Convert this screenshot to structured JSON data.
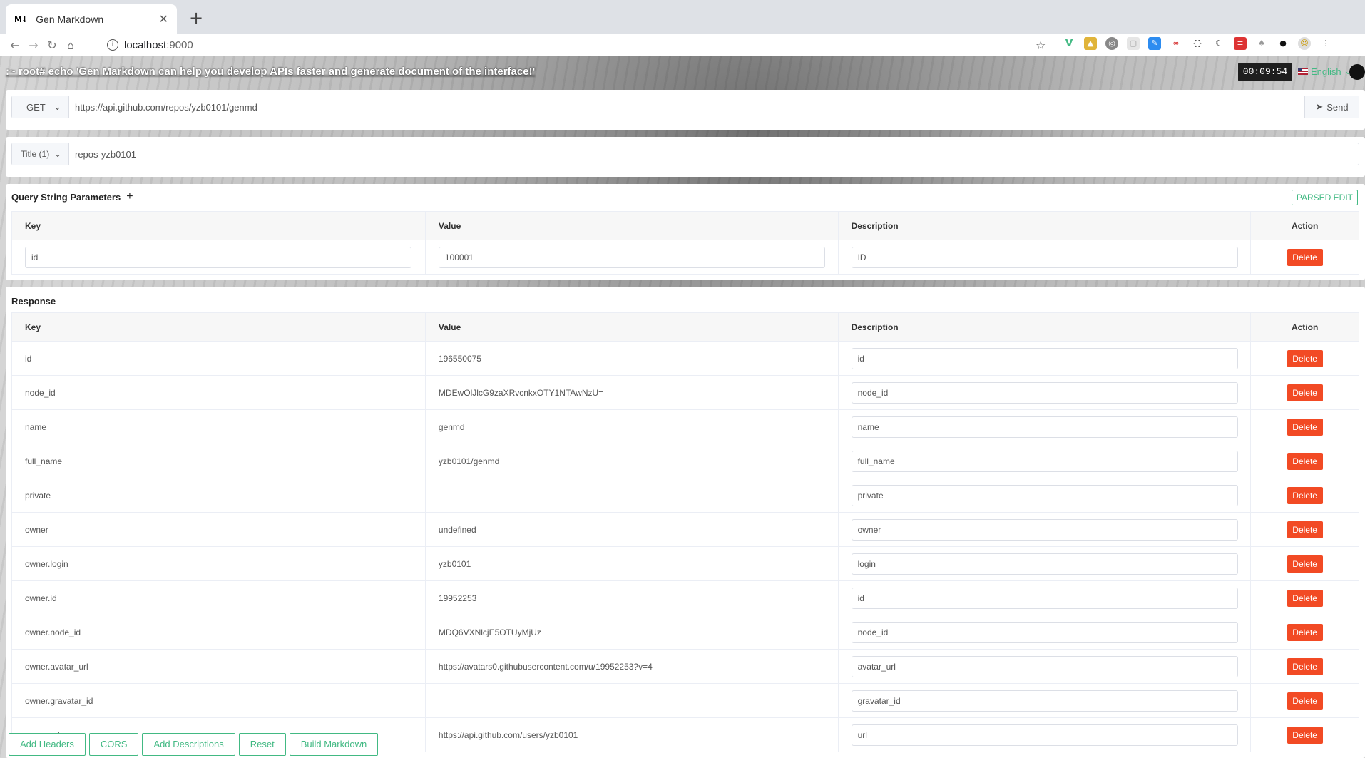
{
  "browser": {
    "tab_title": "Gen Markdown",
    "tab_favicon": "M↓",
    "url_host": "localhost",
    "url_port": ":9000"
  },
  "page": {
    "banner": ":~ root# echo 'Gen Markdown can help you develop APIs faster and generate document of the interface!'",
    "clock": "00:09:54",
    "language": "English"
  },
  "request": {
    "method": "GET",
    "url": "https://api.github.com/repos/yzb0101/genmd",
    "send_label": "Send"
  },
  "title_field": {
    "select_label": "Title (1)",
    "value": "repos-yzb0101"
  },
  "query": {
    "heading": "Query String Parameters",
    "parsed_edit_label": "PARSED EDIT",
    "columns": [
      "Key",
      "Value",
      "Description",
      "Action"
    ],
    "rows": [
      {
        "key": "id",
        "value": "100001",
        "description": "ID",
        "action": "Delete"
      }
    ]
  },
  "response": {
    "heading": "Response",
    "columns": [
      "Key",
      "Value",
      "Description",
      "Action"
    ],
    "rows": [
      {
        "key": "id",
        "value": "196550075",
        "description": "id",
        "action": "Delete"
      },
      {
        "key": "node_id",
        "value": "MDEwOlJlcG9zaXRvcnkxOTY1NTAwNzU=",
        "description": "node_id",
        "action": "Delete"
      },
      {
        "key": "name",
        "value": "genmd",
        "description": "name",
        "action": "Delete"
      },
      {
        "key": "full_name",
        "value": "yzb0101/genmd",
        "description": "full_name",
        "action": "Delete"
      },
      {
        "key": "private",
        "value": "",
        "description": "private",
        "action": "Delete"
      },
      {
        "key": "owner",
        "value": "undefined",
        "description": "owner",
        "action": "Delete"
      },
      {
        "key": "owner.login",
        "value": "yzb0101",
        "description": "login",
        "action": "Delete"
      },
      {
        "key": "owner.id",
        "value": "19952253",
        "description": "id",
        "action": "Delete"
      },
      {
        "key": "owner.node_id",
        "value": "MDQ6VXNlcjE5OTUyMjUz",
        "description": "node_id",
        "action": "Delete"
      },
      {
        "key": "owner.avatar_url",
        "value": "https://avatars0.githubusercontent.com/u/19952253?v=4",
        "description": "avatar_url",
        "action": "Delete"
      },
      {
        "key": "owner.gravatar_id",
        "value": "",
        "description": "gravatar_id",
        "action": "Delete"
      },
      {
        "key": "owner.url",
        "value": "https://api.github.com/users/yzb0101",
        "description": "url",
        "action": "Delete"
      }
    ]
  },
  "actions": {
    "buttons": [
      "Add Headers",
      "CORS",
      "Add Descriptions",
      "Reset",
      "Build Markdown"
    ]
  },
  "colors": {
    "accent": "#42b983",
    "danger": "#f24a24"
  }
}
